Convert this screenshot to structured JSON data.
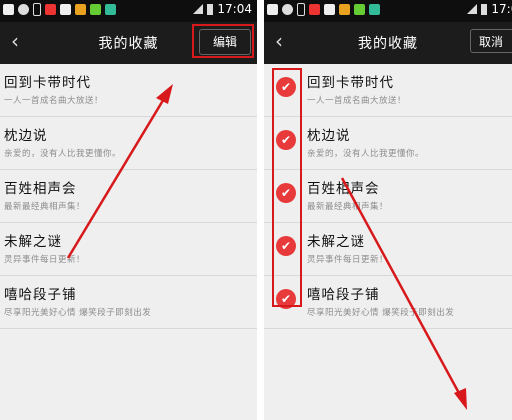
{
  "status_bar": {
    "time": "17:04"
  },
  "nav": {
    "title": "我的收藏",
    "edit_label": "编辑",
    "cancel_label": "取消"
  },
  "favorites": [
    {
      "title": "回到卡带时代",
      "subtitle": "一人一首成名曲大放送！"
    },
    {
      "title": "枕边说",
      "subtitle": "亲爱的，没有人比我更懂你。"
    },
    {
      "title": "百姓相声会",
      "subtitle": "最新最经典相声集！"
    },
    {
      "title": "未解之谜",
      "subtitle": "灵异事件每日更新！"
    },
    {
      "title": "嘻哈段子铺",
      "subtitle": "尽享阳光美好心情 爆笑段子即刻出发"
    }
  ],
  "annotation_color": "#d7191c",
  "check_color": "#e83a3a"
}
